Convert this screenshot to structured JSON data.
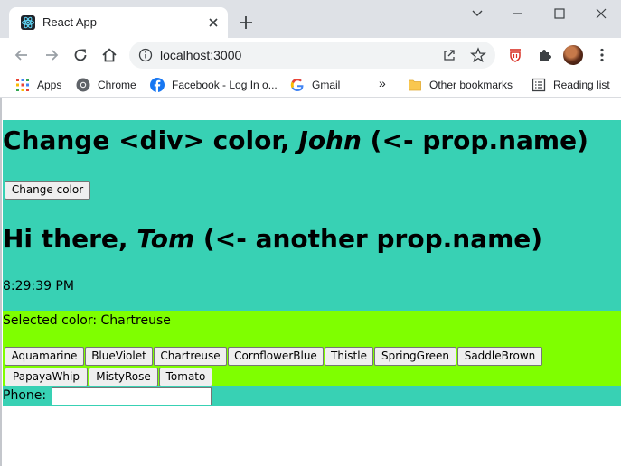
{
  "browser": {
    "tab_title": "React App",
    "url": "localhost:3000",
    "bookmarks": [
      {
        "label": "Apps",
        "icon": "apps-grid-icon"
      },
      {
        "label": "Chrome",
        "icon": "chrome-icon"
      },
      {
        "label": "Facebook - Log In o...",
        "icon": "facebook-icon"
      },
      {
        "label": "Gmail",
        "icon": "google-icon"
      }
    ],
    "overflow_label": "»",
    "other_bookmarks": "Other bookmarks",
    "reading_list": "Reading list"
  },
  "app": {
    "heading1": {
      "prefix": "Change <div> color, ",
      "name": "John",
      "suffix": " (<- prop.name)"
    },
    "change_color_button": "Change color",
    "heading2": {
      "prefix": "Hi there, ",
      "name": "Tom",
      "suffix": " (<- another prop.name)"
    },
    "time": "8:29:39 PM",
    "selected_color_text": "Selected color: Chartreuse",
    "color_buttons": [
      "Aquamarine",
      "BlueViolet",
      "Chartreuse",
      "CornflowerBlue",
      "Thistle",
      "SpringGreen",
      "SaddleBrown",
      "PapayaWhip",
      "MistyRose",
      "Tomato"
    ],
    "phone_label": "Phone:",
    "phone_value": ""
  },
  "colors": {
    "top_section_bg": "#38d1b4",
    "selected_color_bg": "#7fff00"
  }
}
